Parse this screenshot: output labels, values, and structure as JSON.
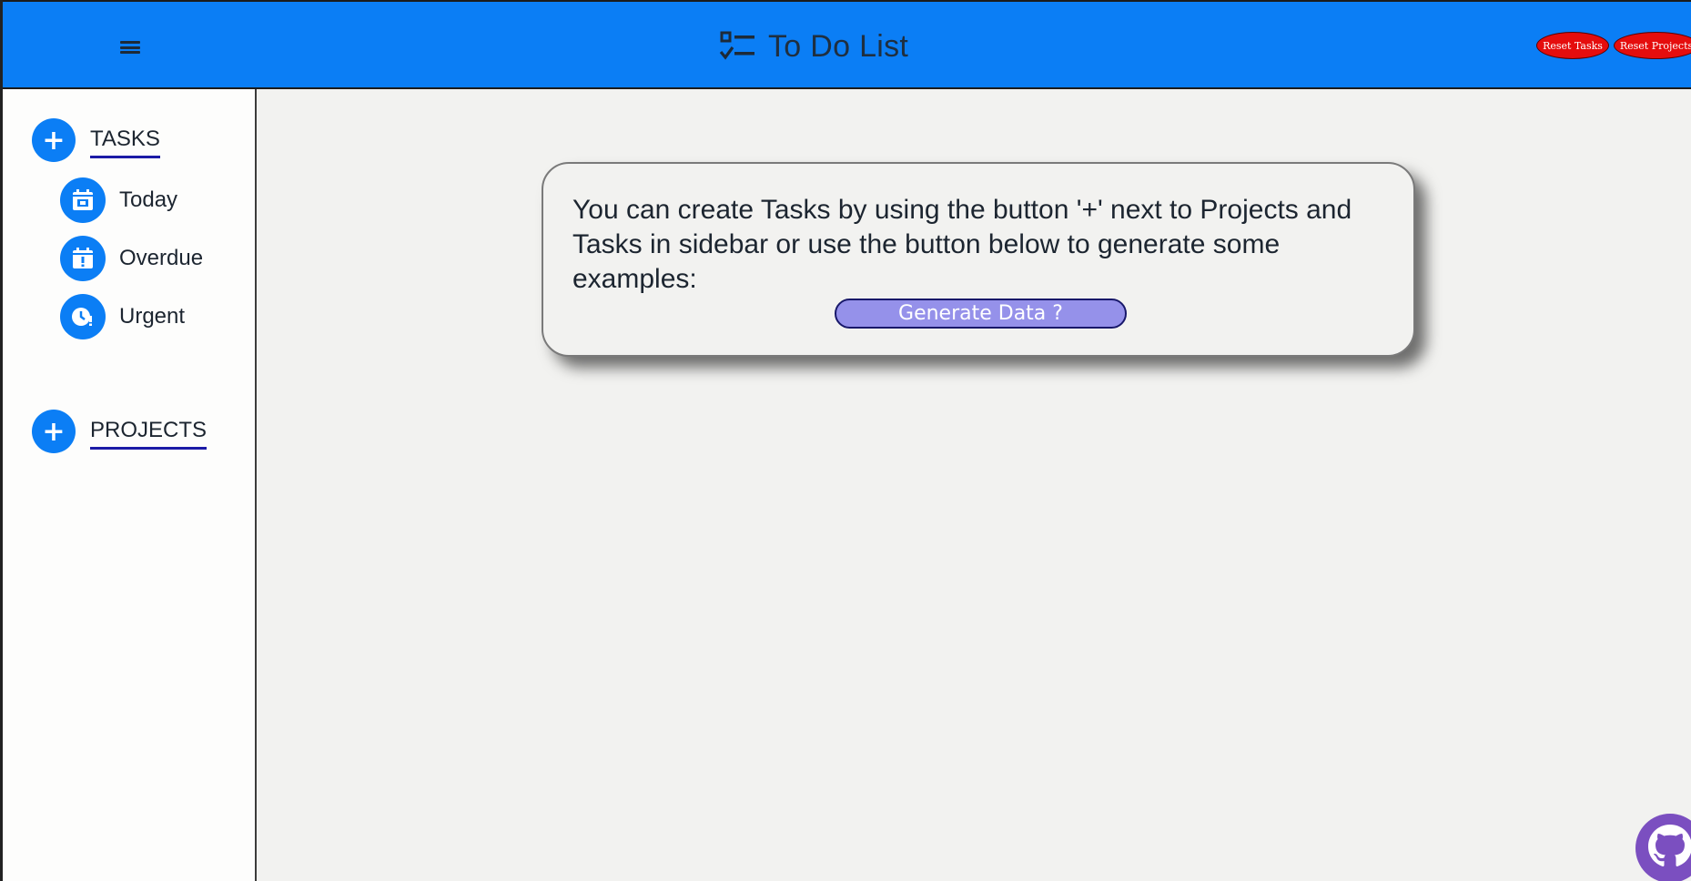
{
  "header": {
    "title": "To Do List",
    "menu_icon": "hamburger-menu-icon",
    "logo_icon": "checklist-icon",
    "reset_tasks_label": "Reset Tasks",
    "reset_projects_label": "Reset Projects"
  },
  "sidebar": {
    "tasks_title": "TASKS",
    "projects_title": "PROJECTS",
    "add_label": "+",
    "items": [
      {
        "label": "Today",
        "icon": "calendar-today-icon"
      },
      {
        "label": "Overdue",
        "icon": "calendar-alert-icon"
      },
      {
        "label": "Urgent",
        "icon": "clock-alert-icon"
      }
    ]
  },
  "main": {
    "message": "You can create Tasks by using the button '+' next to Projects and Tasks in sidebar or use the button below to generate some examples:",
    "generate_label": "Generate Data ?",
    "github_icon": "github-icon"
  },
  "colors": {
    "accent": "#0b7ef5",
    "danger": "#e50d0d",
    "generate_bg": "#9591ea",
    "underline": "#1b1aa6",
    "github": "#7b4fc0"
  }
}
